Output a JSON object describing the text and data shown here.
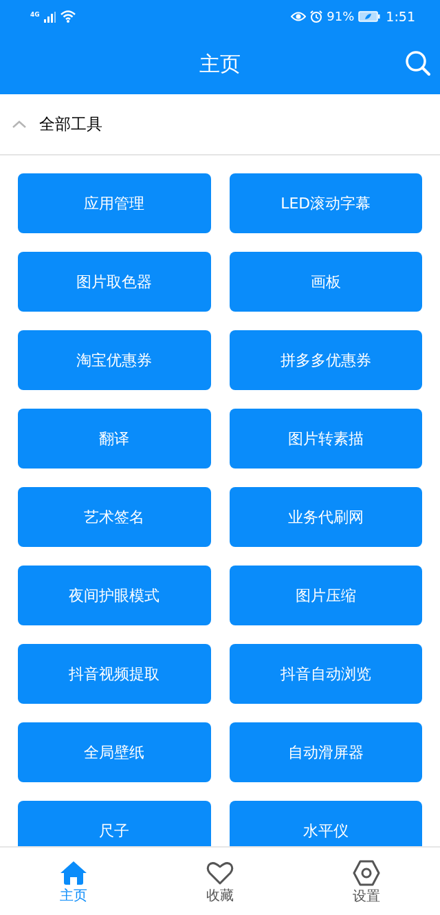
{
  "status_bar": {
    "network": "4G",
    "battery": "91%",
    "time": "1:51"
  },
  "header": {
    "title": "主页"
  },
  "section": {
    "title": "全部工具",
    "expanded": true
  },
  "tools": [
    "应用管理",
    "LED滚动字幕",
    "图片取色器",
    "画板",
    "淘宝优惠券",
    "拼多多优惠券",
    "翻译",
    "图片转素描",
    "艺术签名",
    "业务代刷网",
    "夜间护眼模式",
    "图片压缩",
    "抖音视频提取",
    "抖音自动浏览",
    "全局壁纸",
    "自动滑屏器",
    "尺子",
    "水平仪"
  ],
  "bottom_nav": [
    {
      "label": "主页",
      "kind": "home",
      "selected": true
    },
    {
      "label": "收藏",
      "kind": "favorites",
      "selected": false
    },
    {
      "label": "设置",
      "kind": "settings",
      "selected": false
    }
  ]
}
